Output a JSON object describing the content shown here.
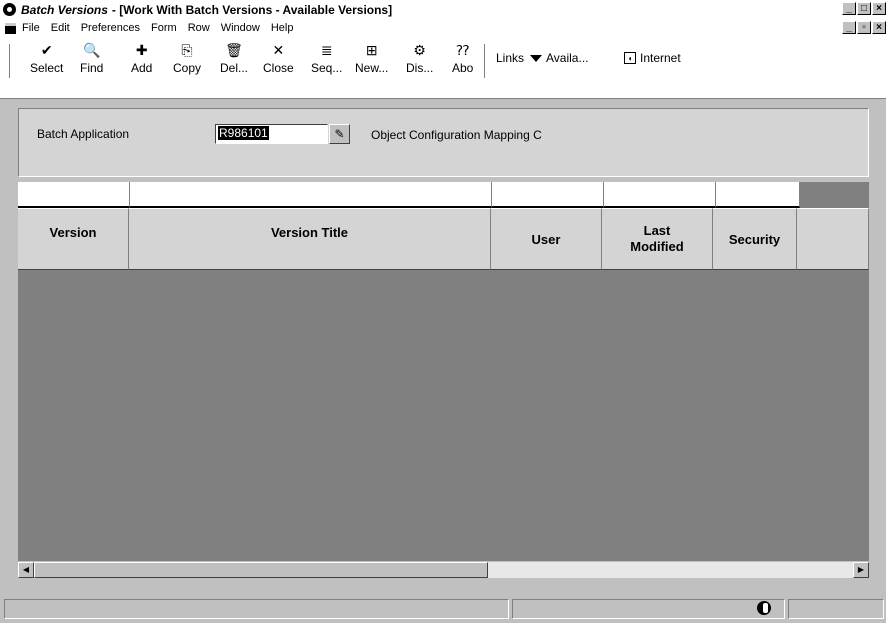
{
  "window": {
    "app_name": "Batch Versions",
    "doc_title": " - [Work With Batch Versions - Available Versions]"
  },
  "menu": [
    "File",
    "Edit",
    "Preferences",
    "Form",
    "Row",
    "Window",
    "Help"
  ],
  "toolbar": {
    "buttons": [
      {
        "label": "Select",
        "icon": "✔"
      },
      {
        "label": "Find",
        "icon": "🔍"
      },
      {
        "label": "Add",
        "icon": "✚"
      },
      {
        "label": "Copy",
        "icon": "⎘"
      },
      {
        "label": "Del...",
        "icon": "🗑"
      },
      {
        "label": "Close",
        "icon": "✕"
      },
      {
        "label": "Seq...",
        "icon": "≣"
      },
      {
        "label": "New...",
        "icon": "⊞"
      },
      {
        "label": "Dis...",
        "icon": "⚙"
      },
      {
        "label": "Abo",
        "icon": "⁇"
      }
    ],
    "links_label": "Links",
    "avail_label": "Availa...",
    "internet_label": "Internet"
  },
  "form": {
    "batch_app_label": "Batch Application",
    "batch_app_value": "R986101",
    "batch_app_desc": "Object Configuration Mapping C"
  },
  "grid": {
    "columns": [
      "Version",
      "Version Title",
      "User",
      "Last\nModified",
      "Security"
    ]
  }
}
